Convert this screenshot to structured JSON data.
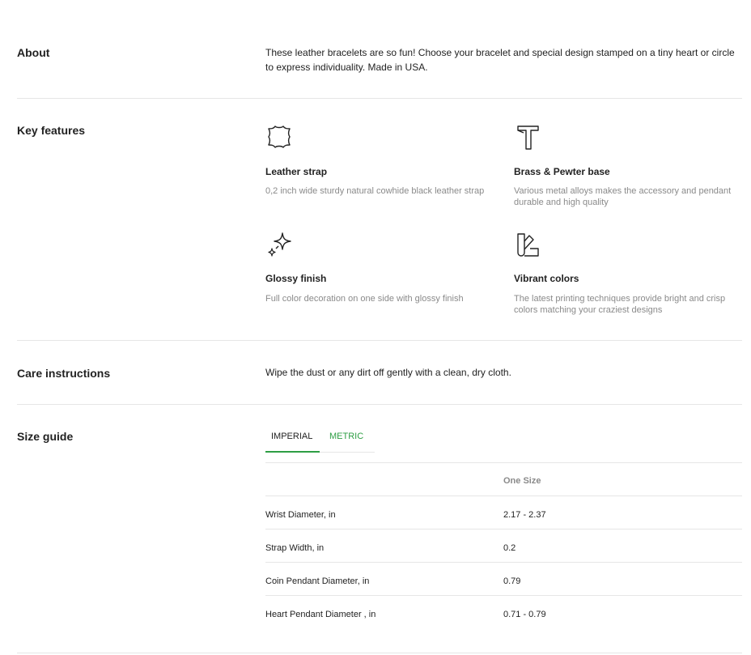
{
  "about": {
    "title": "About",
    "text": "These leather bracelets are so fun! Choose your bracelet and special design stamped on a tiny heart or circle to express individuality. Made in USA."
  },
  "features": {
    "title": "Key features",
    "items": [
      {
        "icon": "leather-hide-icon",
        "name": "Leather strap",
        "desc": "0,2 inch wide sturdy natural cowhide black leather strap"
      },
      {
        "icon": "hammer-icon",
        "name": "Brass & Pewter base",
        "desc": "Various metal alloys makes the accessory and pendant durable and high quality"
      },
      {
        "icon": "sparkle-icon",
        "name": "Glossy finish",
        "desc": "Full color decoration on one side with glossy finish"
      },
      {
        "icon": "color-swatch-icon",
        "name": "Vibrant colors",
        "desc": "The latest printing techniques provide bright and crisp colors matching your craziest designs"
      }
    ]
  },
  "care": {
    "title": "Care instructions",
    "text": "Wipe the dust or any dirt off gently with a clean, dry cloth."
  },
  "size_guide": {
    "title": "Size guide",
    "tabs": [
      "IMPERIAL",
      "METRIC"
    ],
    "active_tab": "IMPERIAL",
    "header": [
      "",
      "One Size"
    ],
    "rows": [
      [
        "Wrist Diameter, in",
        "2.17 - 2.37"
      ],
      [
        "Strap Width, in",
        "0.2"
      ],
      [
        "Coin Pendant Diameter, in",
        "0.79"
      ],
      [
        "Heart Pendant Diameter , in",
        "0.71 - 0.79"
      ]
    ]
  },
  "colors": {
    "accent": "#2e9e44",
    "text": "#222222",
    "muted": "#8a8a8a",
    "divider": "#e6e6e6"
  }
}
